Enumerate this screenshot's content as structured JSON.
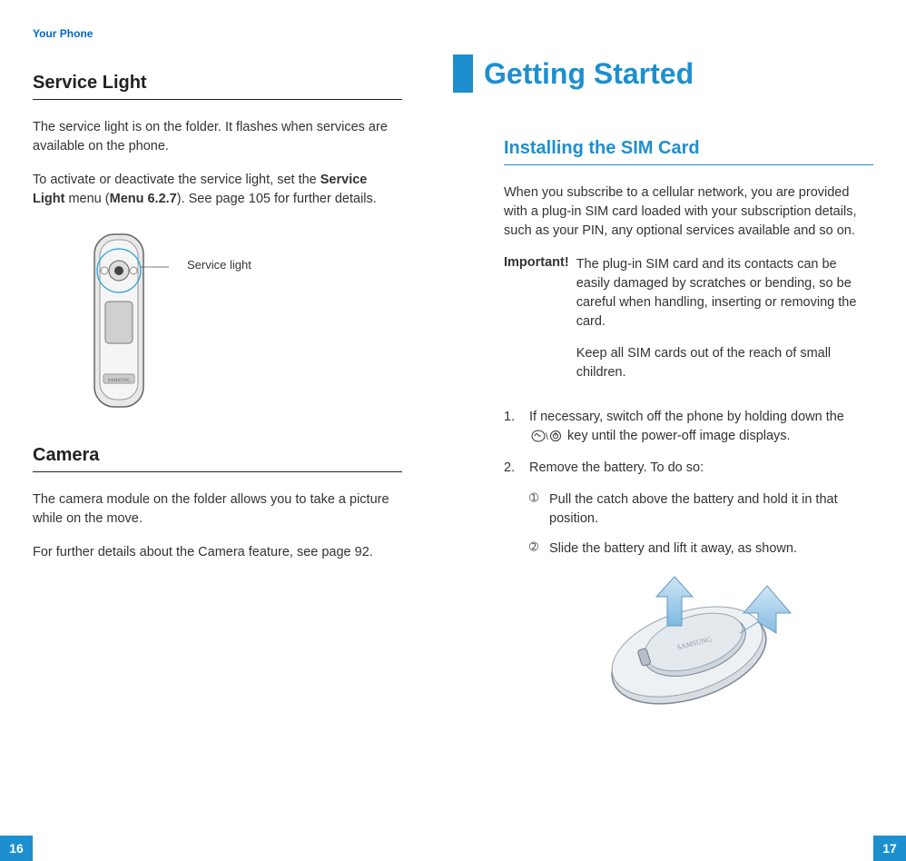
{
  "left": {
    "runningHead": "Your Phone",
    "section1": {
      "title": "Service Light",
      "p1_pre": "The service light is on the folder. It flashes when services are available on the phone.",
      "p2_a": "To activate or deactivate the service light, set the ",
      "p2_b": "Service Light",
      "p2_c": " menu (",
      "p2_d": "Menu 6.2.7",
      "p2_e": "). See page 105 for further details.",
      "callout": "Service light"
    },
    "section2": {
      "title": "Camera",
      "p1": "The camera module on the folder allows you to take a picture while on the move.",
      "p2": "For further details about the Camera feature, see page 92."
    },
    "pageNumber": "16"
  },
  "right": {
    "chapterTitle": "Getting Started",
    "section1": {
      "title": "Installing the SIM Card",
      "p1": "When you subscribe to a cellular network, you are provided with a plug-in SIM card loaded with your subscription details, such as your PIN, any optional services available and so on.",
      "important_label": "Important!",
      "important_p1": "The plug-in SIM card and its contacts can be easily damaged by scratches or bending, so be careful when handling, inserting or removing the card.",
      "important_p2": "Keep all SIM cards out of the reach of small children.",
      "step1_num": "1.",
      "step1_a": "If necessary, switch off the phone by holding down the ",
      "step1_b": " key until the power-off image displays.",
      "step2_num": "2.",
      "step2": "Remove the battery. To do so:",
      "sub1_num": "➀",
      "sub1": "Pull the catch above the battery and hold it in that position.",
      "sub2_num": "➁",
      "sub2": "Slide the battery and lift it away, as shown."
    },
    "pageNumber": "17"
  }
}
